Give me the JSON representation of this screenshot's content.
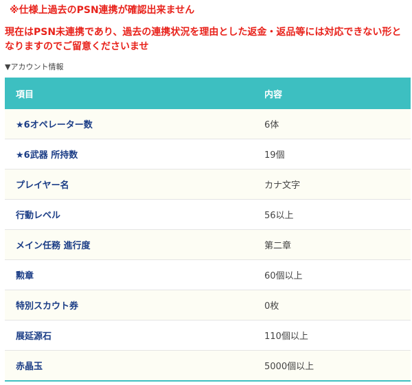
{
  "notices": {
    "line1": "※仕様上過去のPSN連携が確認出来ません",
    "line2": "現在はPSN未連携であり、過去の連携状況を理由とした返金・返品等には対応できない形となりますのでご留意くださいませ"
  },
  "section": {
    "label": "▼アカウント情報"
  },
  "table": {
    "headers": {
      "item": "項目",
      "content": "内容"
    },
    "rows": [
      {
        "item": "★6オペレーター数",
        "value": "6体"
      },
      {
        "item": "★6武器 所持数",
        "value": "19個"
      },
      {
        "item": "プレイヤー名",
        "value": "カナ文字"
      },
      {
        "item": "行動レベル",
        "value": "56以上"
      },
      {
        "item": "メイン任務 進行度",
        "value": "第二章"
      },
      {
        "item": "勲章",
        "value": "60個以上"
      },
      {
        "item": "特別スカウト券",
        "value": "0枚"
      },
      {
        "item": "展延源石",
        "value": "110個以上"
      },
      {
        "item": "赤晶玉",
        "value": "5000個以上"
      }
    ]
  },
  "colors": {
    "header_bg": "#3dbfc1",
    "notice_text": "#e8221b",
    "item_text": "#1b3d86"
  }
}
